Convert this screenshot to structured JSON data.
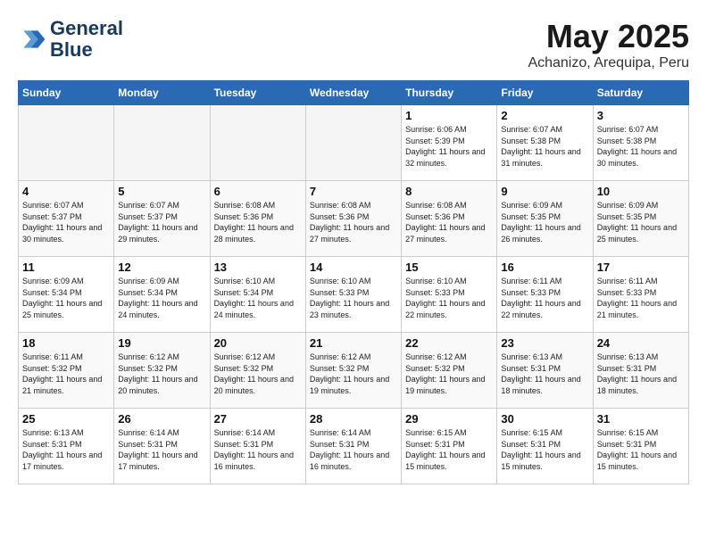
{
  "header": {
    "logo_line1": "General",
    "logo_line2": "Blue",
    "month_year": "May 2025",
    "location": "Achanizo, Arequipa, Peru"
  },
  "days_of_week": [
    "Sunday",
    "Monday",
    "Tuesday",
    "Wednesday",
    "Thursday",
    "Friday",
    "Saturday"
  ],
  "weeks": [
    [
      {
        "day": "",
        "empty": true
      },
      {
        "day": "",
        "empty": true
      },
      {
        "day": "",
        "empty": true
      },
      {
        "day": "",
        "empty": true
      },
      {
        "day": "1",
        "sunrise": "6:06 AM",
        "sunset": "5:39 PM",
        "daylight": "11 hours and 32 minutes."
      },
      {
        "day": "2",
        "sunrise": "6:07 AM",
        "sunset": "5:38 PM",
        "daylight": "11 hours and 31 minutes."
      },
      {
        "day": "3",
        "sunrise": "6:07 AM",
        "sunset": "5:38 PM",
        "daylight": "11 hours and 30 minutes."
      }
    ],
    [
      {
        "day": "4",
        "sunrise": "6:07 AM",
        "sunset": "5:37 PM",
        "daylight": "11 hours and 30 minutes."
      },
      {
        "day": "5",
        "sunrise": "6:07 AM",
        "sunset": "5:37 PM",
        "daylight": "11 hours and 29 minutes."
      },
      {
        "day": "6",
        "sunrise": "6:08 AM",
        "sunset": "5:36 PM",
        "daylight": "11 hours and 28 minutes."
      },
      {
        "day": "7",
        "sunrise": "6:08 AM",
        "sunset": "5:36 PM",
        "daylight": "11 hours and 27 minutes."
      },
      {
        "day": "8",
        "sunrise": "6:08 AM",
        "sunset": "5:36 PM",
        "daylight": "11 hours and 27 minutes."
      },
      {
        "day": "9",
        "sunrise": "6:09 AM",
        "sunset": "5:35 PM",
        "daylight": "11 hours and 26 minutes."
      },
      {
        "day": "10",
        "sunrise": "6:09 AM",
        "sunset": "5:35 PM",
        "daylight": "11 hours and 25 minutes."
      }
    ],
    [
      {
        "day": "11",
        "sunrise": "6:09 AM",
        "sunset": "5:34 PM",
        "daylight": "11 hours and 25 minutes."
      },
      {
        "day": "12",
        "sunrise": "6:09 AM",
        "sunset": "5:34 PM",
        "daylight": "11 hours and 24 minutes."
      },
      {
        "day": "13",
        "sunrise": "6:10 AM",
        "sunset": "5:34 PM",
        "daylight": "11 hours and 24 minutes."
      },
      {
        "day": "14",
        "sunrise": "6:10 AM",
        "sunset": "5:33 PM",
        "daylight": "11 hours and 23 minutes."
      },
      {
        "day": "15",
        "sunrise": "6:10 AM",
        "sunset": "5:33 PM",
        "daylight": "11 hours and 22 minutes."
      },
      {
        "day": "16",
        "sunrise": "6:11 AM",
        "sunset": "5:33 PM",
        "daylight": "11 hours and 22 minutes."
      },
      {
        "day": "17",
        "sunrise": "6:11 AM",
        "sunset": "5:33 PM",
        "daylight": "11 hours and 21 minutes."
      }
    ],
    [
      {
        "day": "18",
        "sunrise": "6:11 AM",
        "sunset": "5:32 PM",
        "daylight": "11 hours and 21 minutes."
      },
      {
        "day": "19",
        "sunrise": "6:12 AM",
        "sunset": "5:32 PM",
        "daylight": "11 hours and 20 minutes."
      },
      {
        "day": "20",
        "sunrise": "6:12 AM",
        "sunset": "5:32 PM",
        "daylight": "11 hours and 20 minutes."
      },
      {
        "day": "21",
        "sunrise": "6:12 AM",
        "sunset": "5:32 PM",
        "daylight": "11 hours and 19 minutes."
      },
      {
        "day": "22",
        "sunrise": "6:12 AM",
        "sunset": "5:32 PM",
        "daylight": "11 hours and 19 minutes."
      },
      {
        "day": "23",
        "sunrise": "6:13 AM",
        "sunset": "5:31 PM",
        "daylight": "11 hours and 18 minutes."
      },
      {
        "day": "24",
        "sunrise": "6:13 AM",
        "sunset": "5:31 PM",
        "daylight": "11 hours and 18 minutes."
      }
    ],
    [
      {
        "day": "25",
        "sunrise": "6:13 AM",
        "sunset": "5:31 PM",
        "daylight": "11 hours and 17 minutes."
      },
      {
        "day": "26",
        "sunrise": "6:14 AM",
        "sunset": "5:31 PM",
        "daylight": "11 hours and 17 minutes."
      },
      {
        "day": "27",
        "sunrise": "6:14 AM",
        "sunset": "5:31 PM",
        "daylight": "11 hours and 16 minutes."
      },
      {
        "day": "28",
        "sunrise": "6:14 AM",
        "sunset": "5:31 PM",
        "daylight": "11 hours and 16 minutes."
      },
      {
        "day": "29",
        "sunrise": "6:15 AM",
        "sunset": "5:31 PM",
        "daylight": "11 hours and 15 minutes."
      },
      {
        "day": "30",
        "sunrise": "6:15 AM",
        "sunset": "5:31 PM",
        "daylight": "11 hours and 15 minutes."
      },
      {
        "day": "31",
        "sunrise": "6:15 AM",
        "sunset": "5:31 PM",
        "daylight": "11 hours and 15 minutes."
      }
    ]
  ]
}
